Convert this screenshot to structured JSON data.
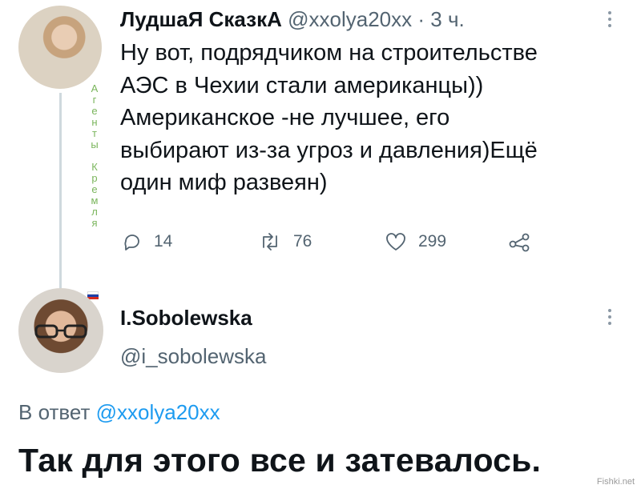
{
  "tweet1": {
    "display_name": "ЛудшаЯ СказкА",
    "handle": "@xxolya20xx",
    "separator": "·",
    "time": "3 ч.",
    "body_lines": [
      "Ну вот, подрядчиком на строительстве",
      "АЭС в Чехии стали американцы))",
      "Американское -не лучшее, его",
      "выбирают из-за угроз и давления)Ещё",
      "один миф развеян)"
    ],
    "actions": {
      "replies": "14",
      "retweets": "76",
      "likes": "299"
    },
    "vertical_letters": [
      "А",
      "г",
      "е",
      "н",
      "т",
      "ы",
      "",
      "К",
      "р",
      "е",
      "м",
      "л",
      "я"
    ]
  },
  "tweet2": {
    "display_name": "I.Sobolewska",
    "handle": "@i_sobolewska",
    "reply_prefix": "В ответ",
    "reply_to": "@xxolya20xx",
    "body": "Так для этого все и затевалось."
  },
  "watermark": "Fishki.net",
  "colors": {
    "text": "#0f1419",
    "secondary": "#536471",
    "link": "#1d9bf0",
    "thread_line": "#cfd9de",
    "vertical_label": "#7ab55c"
  },
  "icons": [
    "reply-icon",
    "retweet-icon",
    "like-icon",
    "share-icon",
    "more-icon",
    "russia-flag-icon"
  ]
}
